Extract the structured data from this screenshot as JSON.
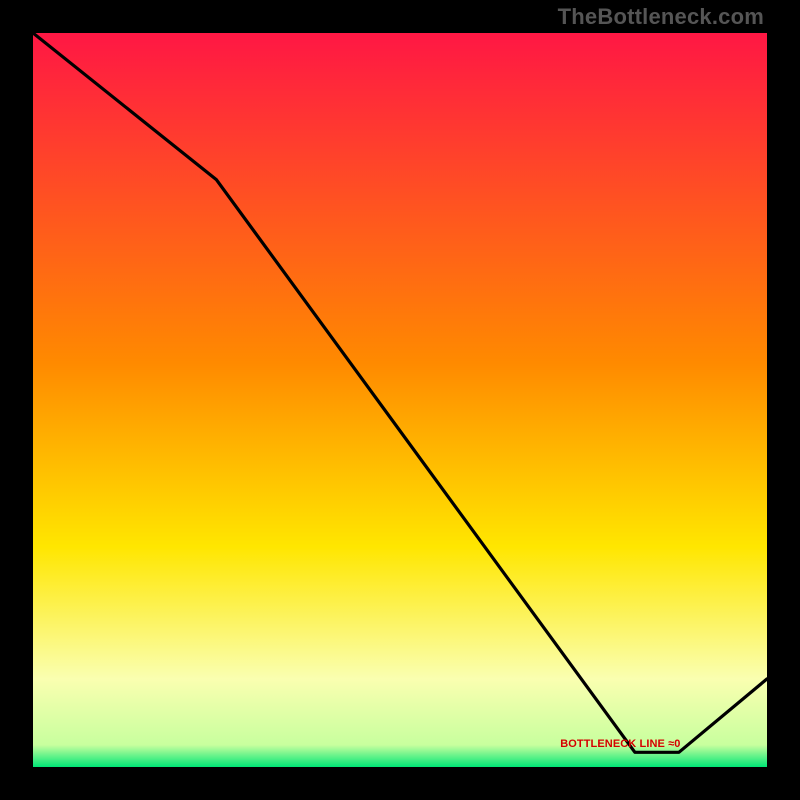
{
  "watermark": "TheBottleneck.com",
  "line_label": "BOTTLENECK LINE ≈0",
  "colors": {
    "gradient_top": "#ff1744",
    "gradient_mid1": "#ff8a00",
    "gradient_mid2": "#ffe600",
    "gradient_mid3": "#faffb0",
    "gradient_bottom": "#00e676",
    "line": "#000000",
    "label": "#d40000",
    "frame": "#000000"
  },
  "chart_data": {
    "type": "line",
    "title": "",
    "xlabel": "",
    "ylabel": "",
    "xlim": [
      0,
      100
    ],
    "ylim": [
      0,
      100
    ],
    "series": [
      {
        "name": "bottleneck-curve",
        "x": [
          0,
          25,
          82,
          88,
          100
        ],
        "y": [
          100,
          80,
          2,
          2,
          12
        ]
      }
    ],
    "gradient_bands": [
      {
        "stop": 0.0,
        "color": "#ff1744"
      },
      {
        "stop": 0.45,
        "color": "#ff8a00"
      },
      {
        "stop": 0.7,
        "color": "#ffe600"
      },
      {
        "stop": 0.88,
        "color": "#faffb0"
      },
      {
        "stop": 0.97,
        "color": "#c8ff9e"
      },
      {
        "stop": 1.0,
        "color": "#00e676"
      }
    ],
    "zero_label": {
      "text": "BOTTLENECK LINE ≈0",
      "x_pct": 80,
      "y_pct": 2
    }
  }
}
